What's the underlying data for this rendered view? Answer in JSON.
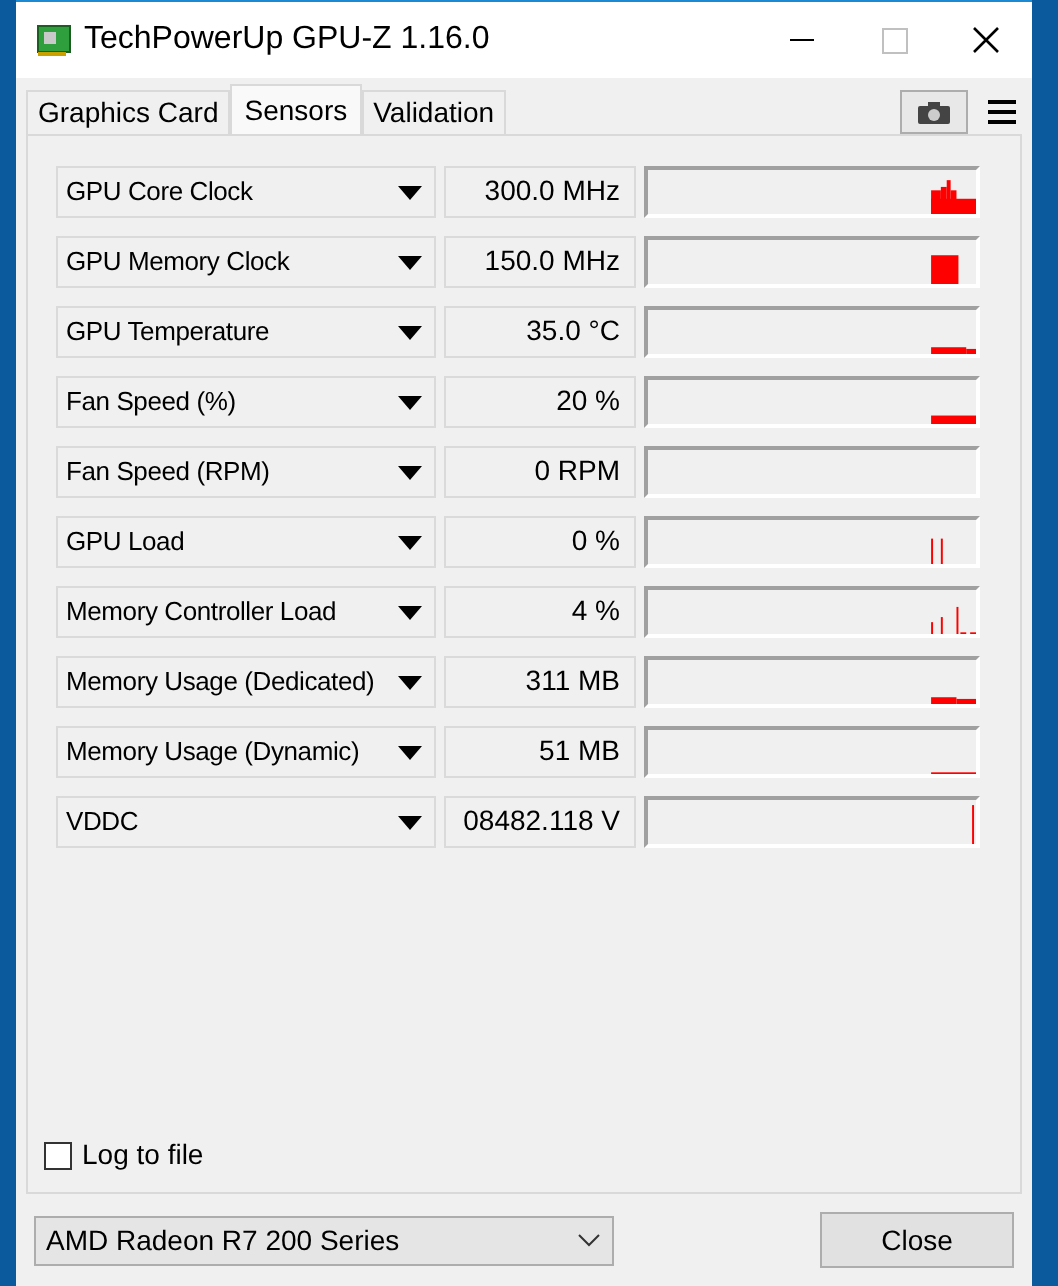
{
  "window": {
    "title": "TechPowerUp GPU-Z 1.16.0"
  },
  "tabs": [
    {
      "label": "Graphics Card",
      "selected": false
    },
    {
      "label": "Sensors",
      "selected": true
    },
    {
      "label": "Validation",
      "selected": false
    }
  ],
  "sensors": [
    {
      "name": "GPU Core Clock",
      "value": "300.0 MHz"
    },
    {
      "name": "GPU Memory Clock",
      "value": "150.0 MHz"
    },
    {
      "name": "GPU Temperature",
      "value": "35.0 °C"
    },
    {
      "name": "Fan Speed (%)",
      "value": "20 %"
    },
    {
      "name": "Fan Speed (RPM)",
      "value": "0 RPM"
    },
    {
      "name": "GPU Load",
      "value": "0 %"
    },
    {
      "name": "Memory Controller Load",
      "value": "4 %"
    },
    {
      "name": "Memory Usage (Dedicated)",
      "value": "311 MB"
    },
    {
      "name": "Memory Usage (Dynamic)",
      "value": "51 MB"
    },
    {
      "name": "VDDC",
      "value": "08482.118 V"
    }
  ],
  "log_to_file": {
    "label": "Log to file",
    "checked": false
  },
  "device_select": {
    "value": "AMD Radeon R7 200 Series"
  },
  "close_button": "Close"
}
